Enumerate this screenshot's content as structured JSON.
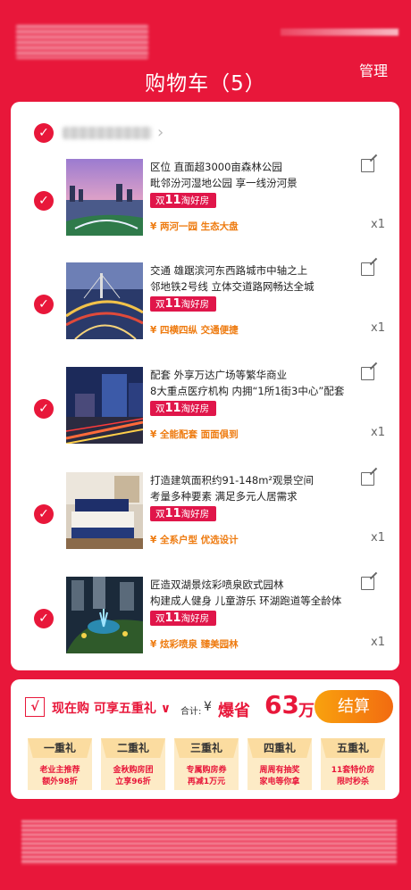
{
  "header": {
    "title": "购物车（5）",
    "manage_label": "管理"
  },
  "cart": {
    "items": [
      {
        "desc_line1": "区位  直面超3000亩森林公园",
        "desc_line2": "毗邻汾河湿地公园 享一线汾河景",
        "badge_prefix": "双",
        "badge_num": "11",
        "badge_suffix": "淘好房",
        "tag": "¥  两河一园 生态大盘",
        "qty": "x1"
      },
      {
        "desc_line1": "交通 雄踞滨河东西路城市中轴之上",
        "desc_line2": "邻地铁2号线  立体交道路网畅达全城",
        "badge_prefix": "双",
        "badge_num": "11",
        "badge_suffix": "淘好房",
        "tag": "¥  四横四纵 交通便捷",
        "qty": "x1"
      },
      {
        "desc_line1": "配套 外享万达广场等繁华商业",
        "desc_line2": "8大重点医疗机构 内拥“1所1街3中心”配套",
        "badge_prefix": "双",
        "badge_num": "11",
        "badge_suffix": "淘好房",
        "tag": "¥  全能配套 面面俱到",
        "qty": "x1"
      },
      {
        "desc_line1": "打造建筑面积约91-148m²观景空间",
        "desc_line2": "考量多种要素 满足多元人居需求",
        "badge_prefix": "双",
        "badge_num": "11",
        "badge_suffix": "淘好房",
        "tag": "¥  全系户型 优选设计",
        "qty": "x1"
      },
      {
        "desc_line1": "匠造双湖景炫彩喷泉欧式园林",
        "desc_line2": "构建成人健身 儿童游乐 环湖跑道等全龄体验空间",
        "badge_prefix": "双",
        "badge_num": "11",
        "badge_suffix": "淘好房",
        "tag": "¥  炫彩喷泉 臻美园林",
        "qty": "x1"
      }
    ]
  },
  "footer": {
    "check_mark": "√",
    "promo": "现在购 可享五重礼",
    "promo_chevron": "∨",
    "total_label": "合计:",
    "total_yen": "¥",
    "total_save": "爆省",
    "total_num": "63",
    "total_unit": "万",
    "checkout_label": "结算",
    "gifts": [
      {
        "title": "一重礼",
        "line1": "老业主推荐",
        "line2": "额外98折"
      },
      {
        "title": "二重礼",
        "line1": "金秋购房团",
        "line2": "立享96折"
      },
      {
        "title": "三重礼",
        "line1": "专属购房券",
        "line2": "再减1万元"
      },
      {
        "title": "四重礼",
        "line1": "周周有抽奖",
        "line2": "家电等你拿"
      },
      {
        "title": "五重礼",
        "line1": "11套特价房",
        "line2": "限时秒杀"
      }
    ]
  },
  "colors": {
    "brand_red": "#e8173a",
    "accent_orange": "#f26b10"
  }
}
